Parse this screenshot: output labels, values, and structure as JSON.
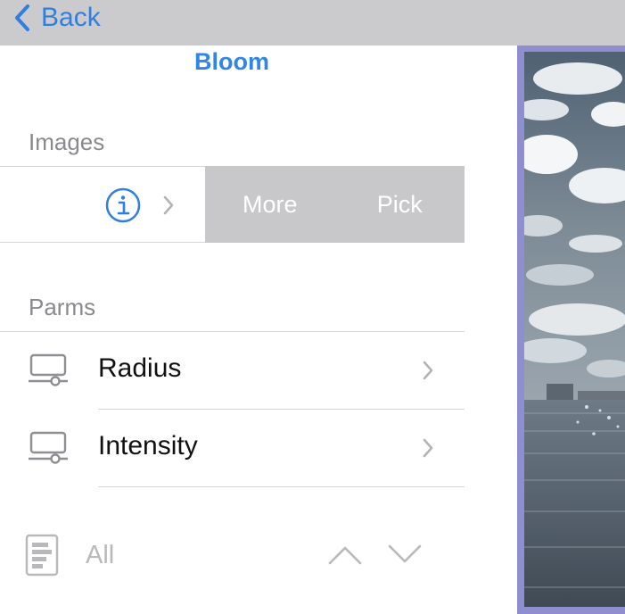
{
  "nav": {
    "back_label": "Back"
  },
  "title": "Bloom",
  "images_section": {
    "header": "Images",
    "swipe_actions": [
      {
        "label": "More"
      },
      {
        "label": "Pick"
      }
    ]
  },
  "parms_section": {
    "header": "Parms",
    "items": [
      {
        "label": "Radius"
      },
      {
        "label": "Intensity"
      }
    ]
  },
  "toolbar": {
    "filter_label": "All"
  },
  "colors": {
    "accent": "#2f86e6",
    "topbar": "#cbcbcd",
    "swipe_bg": "#c8c8cb",
    "image_border": "#8f8fd0",
    "secondary_text": "#8a8a8e"
  },
  "icons": [
    "chevron-left-icon",
    "info-icon",
    "chevron-right-icon",
    "slider-icon",
    "document-list-icon",
    "chevron-up-icon",
    "chevron-down-icon"
  ]
}
